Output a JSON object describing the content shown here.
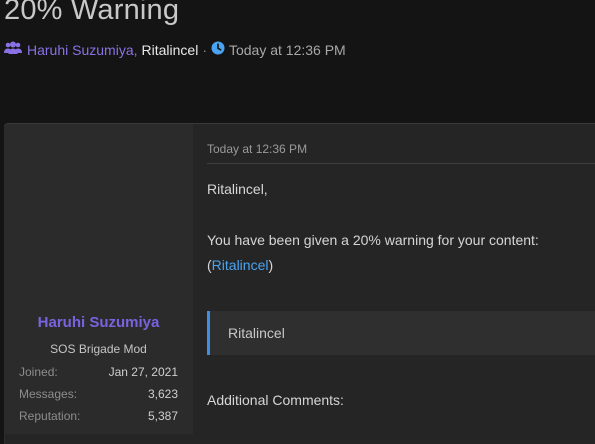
{
  "page": {
    "title": "20% Warning"
  },
  "meta": {
    "participant_1": "Haruhi Suzumiya",
    "comma": ",",
    "participant_2": "Ritalincel",
    "separator": "·",
    "timestamp": "Today at 12:36 PM"
  },
  "author": {
    "name": "Haruhi Suzumiya",
    "title": "SOS Brigade Mod",
    "stats": [
      {
        "key": "Joined:",
        "value": "Jan 27, 2021"
      },
      {
        "key": "Messages:",
        "value": "3,623"
      },
      {
        "key": "Reputation:",
        "value": "5,387"
      }
    ]
  },
  "message": {
    "date": "Today at 12:36 PM",
    "greeting": "Ritalincel,",
    "line1": "You have been given a 20% warning for your content:",
    "paren_open": "(",
    "link": "Ritalincel",
    "paren_close": ")",
    "quote": "Ritalincel",
    "additional": "Additional Comments:"
  },
  "colors": {
    "accent_purple": "#7a63e0",
    "accent_blue": "#4aa3f0",
    "background": "#141414"
  }
}
